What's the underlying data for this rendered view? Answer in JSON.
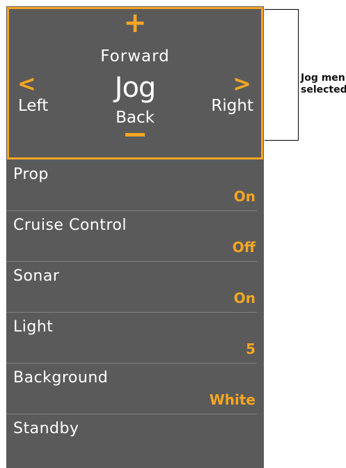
{
  "jog": {
    "plus": "+",
    "forward": "Forward",
    "title": "Jog",
    "left_chevron": "<",
    "right_chevron": ">",
    "left": "Left",
    "right": "Right",
    "back": "Back"
  },
  "menu": {
    "items": [
      {
        "label": "Prop",
        "value": "On"
      },
      {
        "label": "Cruise Control",
        "value": "Off"
      },
      {
        "label": "Sonar",
        "value": "On"
      },
      {
        "label": "Light",
        "value": "5"
      },
      {
        "label": "Background",
        "value": "White"
      },
      {
        "label": "Standby",
        "value": ""
      }
    ]
  },
  "callout": {
    "line1": "Jog menu",
    "line2": "selected"
  },
  "colors": {
    "panel": "#5a5a5a",
    "accent": "#f5a623",
    "text": "#ffffff"
  }
}
